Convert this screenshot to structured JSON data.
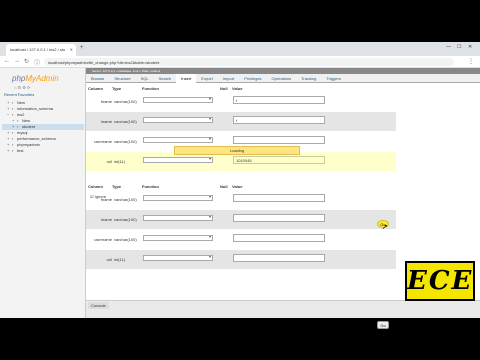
{
  "browser": {
    "tab_title": "localhost / 127.0.0.1 / ins2 / stu",
    "url": "localhost/phpmyadmin/tbl_change.php?db=ins2&table=student"
  },
  "sidebar": {
    "logo_php": "php",
    "logo_my": "MyAdmin",
    "recent": "Recent   Favorites",
    "items": [
      {
        "label": "New",
        "indent": 1,
        "selected": false
      },
      {
        "label": "information_schema",
        "indent": 1,
        "selected": false
      },
      {
        "label": "ins2",
        "indent": 1,
        "selected": false
      },
      {
        "label": "New",
        "indent": 2,
        "selected": false
      },
      {
        "label": "student",
        "indent": 2,
        "selected": true
      },
      {
        "label": "mysql",
        "indent": 1,
        "selected": false
      },
      {
        "label": "performance_schema",
        "indent": 1,
        "selected": false
      },
      {
        "label": "phpmyadmin",
        "indent": 1,
        "selected": false
      },
      {
        "label": "test",
        "indent": 1,
        "selected": false
      }
    ]
  },
  "breadcrumb": "Server: 127.0.0.1 » Database: ins2 » Table: student",
  "tabs": [
    "Browse",
    "Structure",
    "SQL",
    "Search",
    "Insert",
    "Export",
    "Import",
    "Privileges",
    "Operations",
    "Tracking",
    "Triggers"
  ],
  "active_tab": "Insert",
  "headers": {
    "column": "Column",
    "type": "Type",
    "function": "Function",
    "null": "Null",
    "value": "Value"
  },
  "form1": {
    "rows": [
      {
        "column": "fname",
        "type": "varchar(100)",
        "value": "t"
      },
      {
        "column": "lname",
        "type": "varchar(100)",
        "value": "t"
      },
      {
        "column": "username",
        "type": "varchar(100)",
        "value": ""
      },
      {
        "column": "roll",
        "type": "int(11)",
        "value": "1010045"
      }
    ]
  },
  "loading": "Loading",
  "go": "Go",
  "ignore": "Ignore",
  "form2": {
    "rows": [
      {
        "column": "fname",
        "type": "varchar(100)",
        "value": ""
      },
      {
        "column": "lname",
        "type": "varchar(100)",
        "value": ""
      },
      {
        "column": "username",
        "type": "varchar(100)",
        "value": ""
      },
      {
        "column": "roll",
        "type": "int(11)",
        "value": ""
      }
    ]
  },
  "console": "Console",
  "watermark": "ECE"
}
